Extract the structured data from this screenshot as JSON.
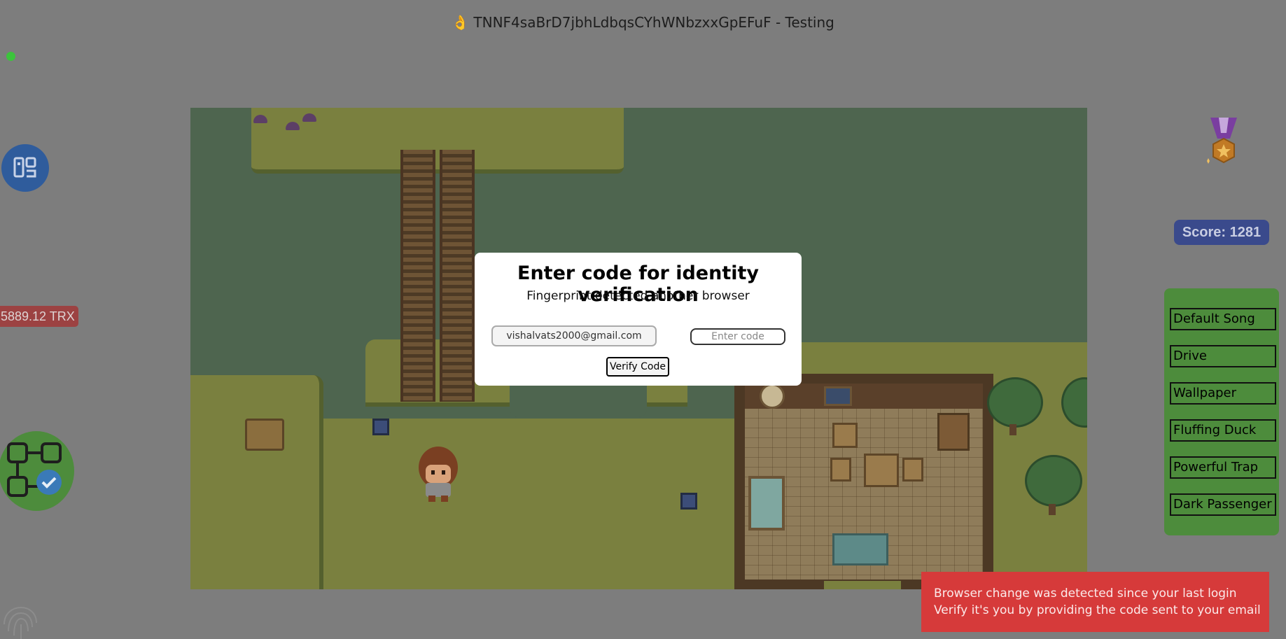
{
  "header": {
    "title": "👌 TNNF4saBrD7jbhLdbqsCYhWNbzxxGpEFuF - Testing"
  },
  "left_panel": {
    "balance": "5889.12 TRX",
    "icons": [
      "qr-code-icon",
      "flowchart-check-icon",
      "fingerprint-icon"
    ]
  },
  "modal": {
    "title": "Enter code for identity verification",
    "subtitle": "Fingerprint detected another browser",
    "email_value": "vishalvats2000@gmail.com",
    "code_placeholder": "Enter code",
    "verify_label": "Verify Code"
  },
  "right_panel": {
    "score_text": "Score: 1281",
    "songs": [
      "Default Song",
      "Drive",
      "Wallpaper",
      "Fluffing Duck",
      "Powerful Trap",
      "Dark Passenger"
    ]
  },
  "toast": {
    "line1": "Browser change was detected since your last login",
    "line2": "Verify it's you by providing the code sent to your email"
  },
  "colors": {
    "overlay": "#7d7d7d",
    "score_bg": "#3a4a8c",
    "playlist_bg": "#4d8c3c",
    "toast_bg": "#d63a3a",
    "balance_bg": "#9c4242"
  }
}
